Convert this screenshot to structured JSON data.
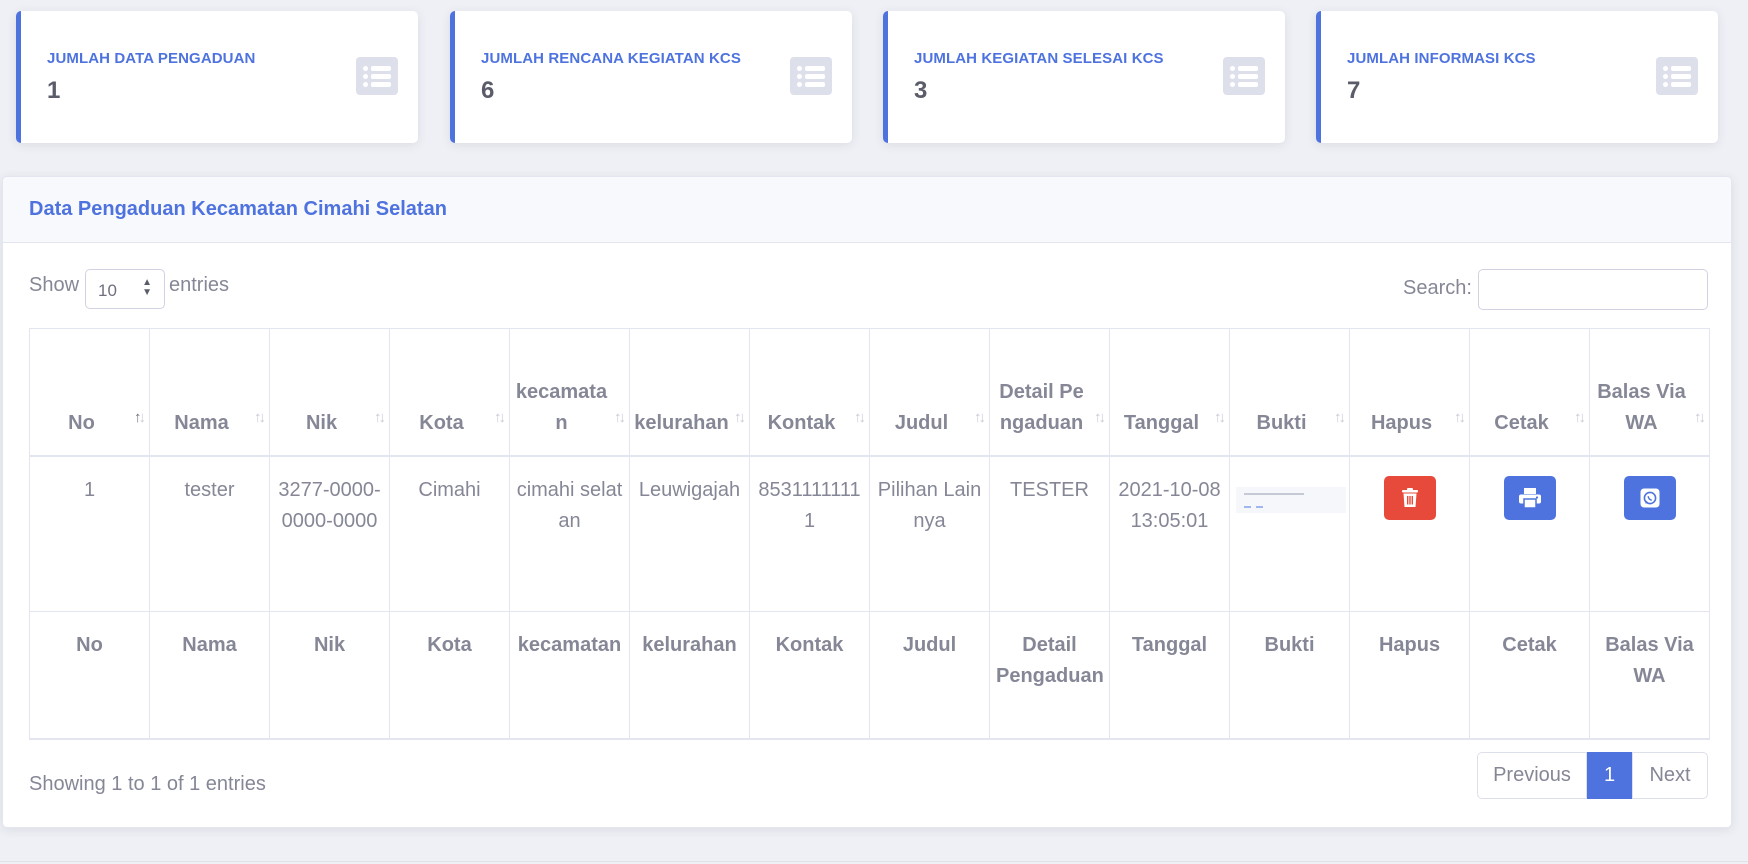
{
  "cards": [
    {
      "label": "JUMLAH DATA PENGADUAN",
      "value": "1",
      "icon": "list-icon"
    },
    {
      "label": "JUMLAH RENCANA KEGIATAN KCS",
      "value": "6",
      "icon": "list-icon"
    },
    {
      "label": "JUMLAH KEGIATAN SELESAI KCS",
      "value": "3",
      "icon": "list-icon"
    },
    {
      "label": "JUMLAH INFORMASI KCS",
      "value": "7",
      "icon": "list-icon"
    }
  ],
  "panel": {
    "title": "Data Pengaduan Kecamatan Cimahi Selatan",
    "show_label": "Show",
    "page_size": "10",
    "entries_label": "entries",
    "search_label": "Search:",
    "search_value": ""
  },
  "table": {
    "headers": [
      "No",
      "Nama",
      "Nik",
      "Kota",
      "kecamatan",
      "kelurahan",
      "Kontak",
      "Judul",
      "Detail Pengaduan",
      "Tanggal",
      "Bukti",
      "Hapus",
      "Cetak",
      "Balas Via WA"
    ],
    "rows": [
      {
        "no": "1",
        "nama": "tester",
        "nik": "3277-0000-0000-0000",
        "kota": "Cimahi",
        "kecamatan": "cimahi selatan",
        "kelurahan": "Leuwigajah",
        "kontak": "85311111111",
        "judul": "Pilihan Lainnya",
        "detail": "TESTER",
        "tanggal": "2021-10-08 13:05:01",
        "bukti": "image-thumbnail",
        "hapus": "trash-icon",
        "cetak": "print-icon",
        "balas": "whatsapp-icon"
      }
    ]
  },
  "colors": {
    "primary": "#4e73df",
    "danger": "#e74a3b",
    "text": "#858796",
    "value": "#5a5c69"
  },
  "footer": {
    "info": "Showing 1 to 1 of 1 entries",
    "previous": "Previous",
    "current_page": "1",
    "next": "Next"
  }
}
